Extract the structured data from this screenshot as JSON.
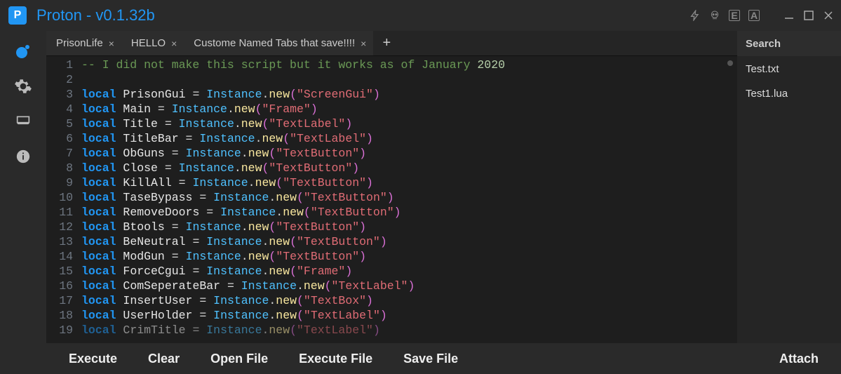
{
  "titlebar": {
    "logo_letter": "P",
    "title": "Proton - v0.1.32b"
  },
  "sidebar": {
    "items": [
      {
        "name": "logo-dot-icon",
        "active": true
      },
      {
        "name": "gear-icon",
        "active": false
      },
      {
        "name": "monitor-icon",
        "active": false
      },
      {
        "name": "info-icon",
        "active": false
      }
    ]
  },
  "tabs": [
    {
      "label": "PrisonLife"
    },
    {
      "label": "HELLO"
    },
    {
      "label": "Custome Named Tabs that save!!!!"
    }
  ],
  "code": {
    "comment_prefix": "-- I did not make this script but it works as of January ",
    "comment_year": "2020",
    "lines": [
      {
        "var": "PrisonGui",
        "arg": "ScreenGui"
      },
      {
        "var": "Main",
        "arg": "Frame"
      },
      {
        "var": "Title",
        "arg": "TextLabel"
      },
      {
        "var": "TitleBar",
        "arg": "TextLabel"
      },
      {
        "var": "ObGuns",
        "arg": "TextButton"
      },
      {
        "var": "Close",
        "arg": "TextButton"
      },
      {
        "var": "KillAll",
        "arg": "TextButton"
      },
      {
        "var": "TaseBypass",
        "arg": "TextButton"
      },
      {
        "var": "RemoveDoors",
        "arg": "TextButton"
      },
      {
        "var": "Btools",
        "arg": "TextButton"
      },
      {
        "var": "BeNeutral",
        "arg": "TextButton"
      },
      {
        "var": "ModGun",
        "arg": "TextButton"
      },
      {
        "var": "ForceCgui",
        "arg": "Frame"
      },
      {
        "var": "ComSeperateBar",
        "arg": "TextLabel"
      },
      {
        "var": "InsertUser",
        "arg": "TextBox"
      },
      {
        "var": "UserHolder",
        "arg": "TextLabel"
      },
      {
        "var": "CrimTitle",
        "arg": "TextLabel"
      }
    ],
    "kw_local": "local",
    "cls_name": "Instance",
    "fn_name": "new",
    "eq": " = ",
    "dot": ".",
    "lp": "(",
    "rp": ")",
    "q": "\""
  },
  "search": {
    "label": "Search",
    "files": [
      "Test.txt",
      "Test1.lua"
    ]
  },
  "buttons": {
    "execute": "Execute",
    "clear": "Clear",
    "open": "Open File",
    "exec_file": "Execute File",
    "save": "Save File",
    "attach": "Attach"
  }
}
